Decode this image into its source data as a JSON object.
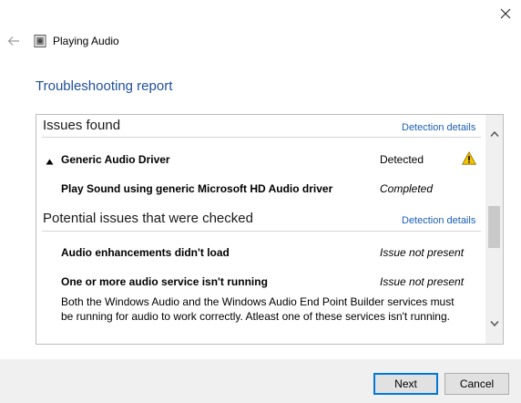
{
  "window": {
    "title": "Playing Audio"
  },
  "report": {
    "heading": "Troubleshooting report"
  },
  "issues_found": {
    "title": "Issues found",
    "link": "Detection details",
    "items": [
      {
        "name": "Generic Audio Driver",
        "status": "Detected",
        "expanded": true,
        "icon": "warning-icon"
      },
      {
        "name": "Play Sound using generic Microsoft HD Audio driver",
        "status": "Completed"
      }
    ]
  },
  "potential_issues": {
    "title": "Potential issues that were checked",
    "link": "Detection details",
    "items": [
      {
        "name": "Audio enhancements didn't load",
        "status": "Issue not present"
      },
      {
        "name": "One or more audio service isn't running",
        "status": "Issue not present",
        "description": "Both the Windows Audio and the Windows Audio End Point Builder services must be running for audio to work correctly. Atleast one of these services isn't running."
      }
    ]
  },
  "buttons": {
    "next": "Next",
    "cancel": "Cancel"
  },
  "colors": {
    "heading": "#1f4f9a",
    "link": "#1a5fb4",
    "warning": "#f5c400"
  }
}
